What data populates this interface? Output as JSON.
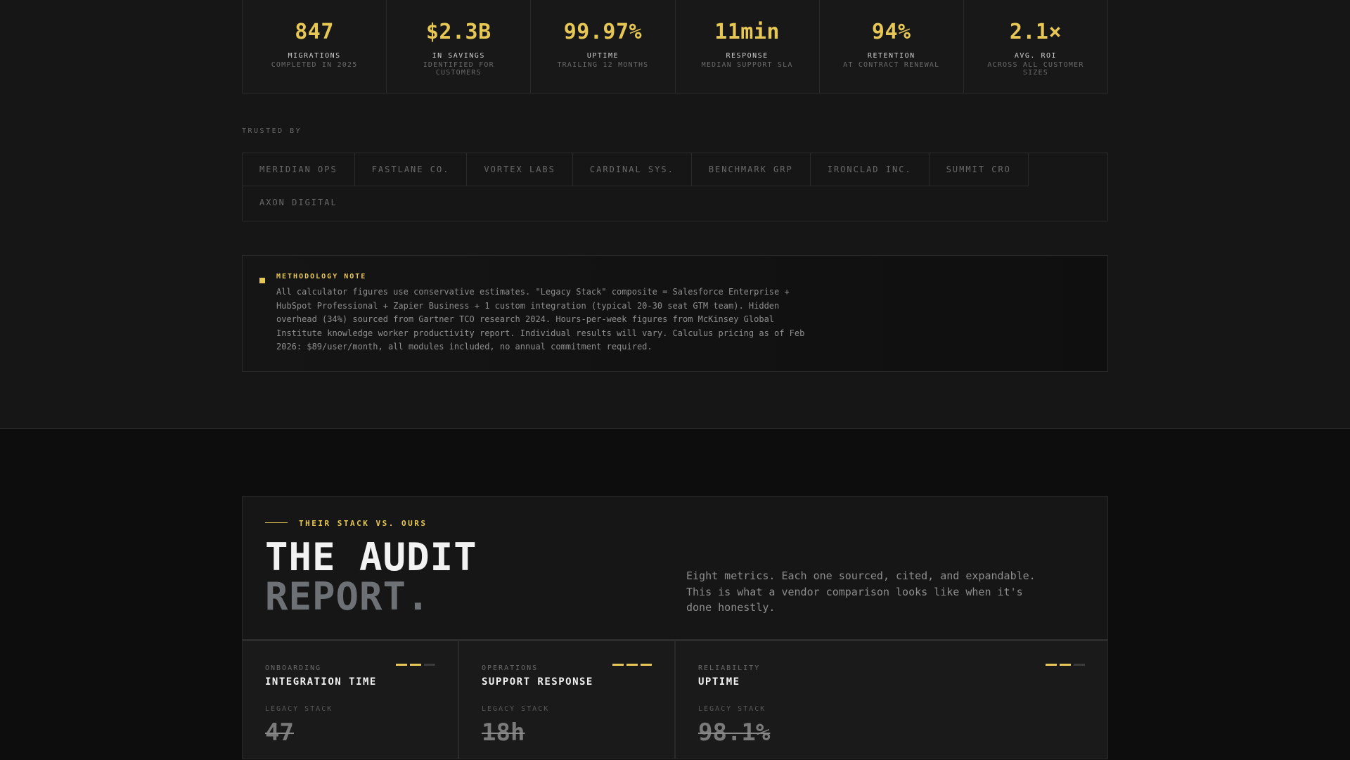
{
  "stats": [
    {
      "value": "847",
      "label": "MIGRATIONS",
      "sub": "COMPLETED IN 2025"
    },
    {
      "value": "$2.3B",
      "label": "IN SAVINGS",
      "sub": "IDENTIFIED FOR CUSTOMERS"
    },
    {
      "value": "99.97%",
      "label": "UPTIME",
      "sub": "TRAILING 12 MONTHS"
    },
    {
      "value": "11min",
      "label": "RESPONSE",
      "sub": "MEDIAN SUPPORT SLA"
    },
    {
      "value": "94%",
      "label": "RETENTION",
      "sub": "AT CONTRACT RENEWAL"
    },
    {
      "value": "2.1×",
      "label": "AVG. ROI",
      "sub": "ACROSS ALL CUSTOMER SIZES"
    }
  ],
  "trusted": {
    "label": "TRUSTED BY",
    "logos": [
      "MERIDIAN OPS",
      "FASTLANE CO.",
      "VORTEX LABS",
      "CARDINAL SYS.",
      "BENCHMARK GRP",
      "IRONCLAD INC.",
      "SUMMIT CRO",
      "AXON DIGITAL"
    ]
  },
  "methodology": {
    "title": "METHODOLOGY NOTE",
    "text": "All calculator figures use conservative estimates. \"Legacy Stack\" composite = Salesforce Enterprise + HubSpot Professional + Zapier Business + 1 custom integration (typical 20-30 seat GTM team). Hidden overhead (34%) sourced from Gartner TCO research 2024. Hours-per-week figures from McKinsey Global Institute knowledge worker productivity report. Individual results will vary. Calculus pricing as of Feb 2026: $89/user/month, all modules included, no annual commitment required."
  },
  "audit": {
    "eyebrow": "THEIR STACK VS. OURS",
    "title_line1": "THE AUDIT",
    "title_line2": "REPORT.",
    "description": "Eight metrics. Each one sourced, cited, and expandable. This is what a vendor comparison looks like when it's done honestly."
  },
  "cards": [
    {
      "category": "ONBOARDING",
      "name": "INTEGRATION TIME",
      "legacy_label": "LEGACY STACK",
      "legacy_value": "47",
      "rating": 2
    },
    {
      "category": "OPERATIONS",
      "name": "SUPPORT RESPONSE",
      "legacy_label": "LEGACY STACK",
      "legacy_value": "18h",
      "rating": 3
    },
    {
      "category": "RELIABILITY",
      "name": "UPTIME",
      "legacy_label": "LEGACY STACK",
      "legacy_value": "98.1%",
      "rating": 2
    }
  ],
  "colors": {
    "accent": "#e6c655",
    "background": "#161616",
    "border": "#2a2a2a"
  }
}
